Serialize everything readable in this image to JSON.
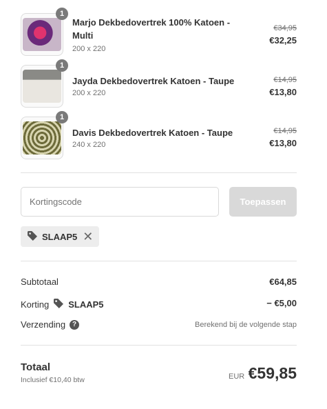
{
  "items": [
    {
      "quantity": "1",
      "title": "Marjo Dekbedovertrek 100% Katoen - Multi",
      "variant": "200 x 220",
      "old_price": "€34,95",
      "price": "€32,25"
    },
    {
      "quantity": "1",
      "title": "Jayda Dekbedovertrek Katoen - Taupe",
      "variant": "200 x 220",
      "old_price": "€14,95",
      "price": "€13,80"
    },
    {
      "quantity": "1",
      "title": "Davis Dekbedovertrek Katoen - Taupe",
      "variant": "240 x 220",
      "old_price": "€14,95",
      "price": "€13,80"
    }
  ],
  "discount": {
    "placeholder": "Kortingscode",
    "apply_label": "Toepassen",
    "applied_code": "SLAAP5",
    "tag_icon": "tag-icon",
    "remove_icon": "close-icon"
  },
  "summary": {
    "subtotal_label": "Subtotaal",
    "subtotal_value": "€64,85",
    "discount_label": "Korting",
    "discount_code": "SLAAP5",
    "discount_value": "− €5,00",
    "shipping_label": "Verzending",
    "shipping_value": "Berekend bij de volgende stap",
    "help_icon": "question-icon"
  },
  "total": {
    "label": "Totaal",
    "tax_note": "Inclusief €10,40 btw",
    "currency": "EUR",
    "amount": "€59,85"
  }
}
